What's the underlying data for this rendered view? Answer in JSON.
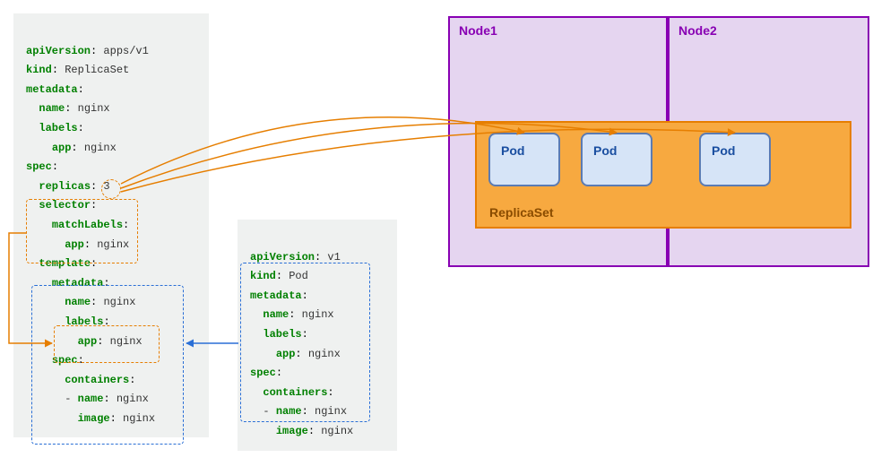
{
  "yaml1": {
    "l1": {
      "k": "apiVersion",
      "v": "apps/v1"
    },
    "l2": {
      "k": "kind",
      "v": "ReplicaSet"
    },
    "l3": {
      "k": "metadata",
      "v": ""
    },
    "l4": {
      "k": "name",
      "v": "nginx"
    },
    "l5": {
      "k": "labels",
      "v": ""
    },
    "l6": {
      "k": "app",
      "v": "nginx"
    },
    "l7": {
      "k": "spec",
      "v": ""
    },
    "l8": {
      "k": "replicas",
      "v": "3"
    },
    "l9": {
      "k": "selector",
      "v": ""
    },
    "l10": {
      "k": "matchLabels",
      "v": ""
    },
    "l11": {
      "k": "app",
      "v": "nginx"
    },
    "l12": {
      "k": "template",
      "v": ""
    },
    "l13": {
      "k": "metadata",
      "v": ""
    },
    "l14": {
      "k": "name",
      "v": "nginx"
    },
    "l15": {
      "k": "labels",
      "v": ""
    },
    "l16": {
      "k": "app",
      "v": "nginx"
    },
    "l17": {
      "k": "spec",
      "v": ""
    },
    "l18": {
      "k": "containers",
      "v": ""
    },
    "l19": {
      "prefix": "- ",
      "k": "name",
      "v": "nginx"
    },
    "l20": {
      "k": "image",
      "v": "nginx"
    }
  },
  "yaml2": {
    "l1": {
      "k": "apiVersion",
      "v": "v1"
    },
    "l2": {
      "k": "kind",
      "v": "Pod"
    },
    "l3": {
      "k": "metadata",
      "v": ""
    },
    "l4": {
      "k": "name",
      "v": "nginx"
    },
    "l5": {
      "k": "labels",
      "v": ""
    },
    "l6": {
      "k": "app",
      "v": "nginx"
    },
    "l7": {
      "k": "spec",
      "v": ""
    },
    "l8": {
      "k": "containers",
      "v": ""
    },
    "l9": {
      "prefix": "- ",
      "k": "name",
      "v": "nginx"
    },
    "l10": {
      "k": "image",
      "v": "nginx"
    }
  },
  "nodes": {
    "n1": "Node1",
    "n2": "Node2"
  },
  "replicaset_label": "ReplicaSet",
  "pod_label": "Pod"
}
